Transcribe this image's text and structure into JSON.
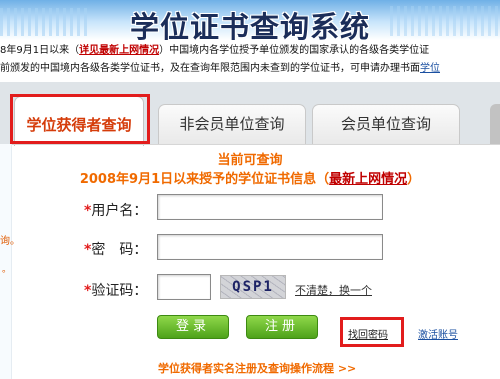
{
  "header": {
    "title": "学位证书查询系统"
  },
  "notice": {
    "line1_prefix": "8年9月1日以来（",
    "line1_link": "详见最新上网情况",
    "line1_suffix": "）中国境内各学位授予单位颁发的国家承认的各级各类学位证",
    "line2_text": "前颁发的中国境内各级各类学位证书，及在查询年限范围内未查到的学位证书，可申请办理书面",
    "line2_link": "学位"
  },
  "tabs": [
    {
      "label": "学位获得者查询",
      "active": true
    },
    {
      "label": "非会员单位查询",
      "active": false
    },
    {
      "label": "会员单位查询",
      "active": false
    }
  ],
  "left_strip": {
    "text": "询。",
    "dot": "。"
  },
  "main": {
    "heading": "当前可查询",
    "info_prefix": "2008年9月1日以来授予的学位证书信息（",
    "info_link": "最新上网情况",
    "info_suffix": "）"
  },
  "form": {
    "required_mark": "*",
    "username_label": "用户名：",
    "password_label": "密　码：",
    "captcha_label": "验证码：",
    "username_value": "",
    "password_value": "",
    "captcha_value": "",
    "captcha_text": "QSP1",
    "refresh_text": "不清楚，换一个",
    "login_label": "登录",
    "register_label": "注册",
    "forgot_label": "找回密码",
    "activate_label": "激活账号",
    "guide_link": "学位获得者实名注册及查询操作流程 >>"
  },
  "colors": {
    "accent": "#f06a00",
    "highlight_box": "#e21c1c",
    "button_green": "#4ea21a"
  }
}
